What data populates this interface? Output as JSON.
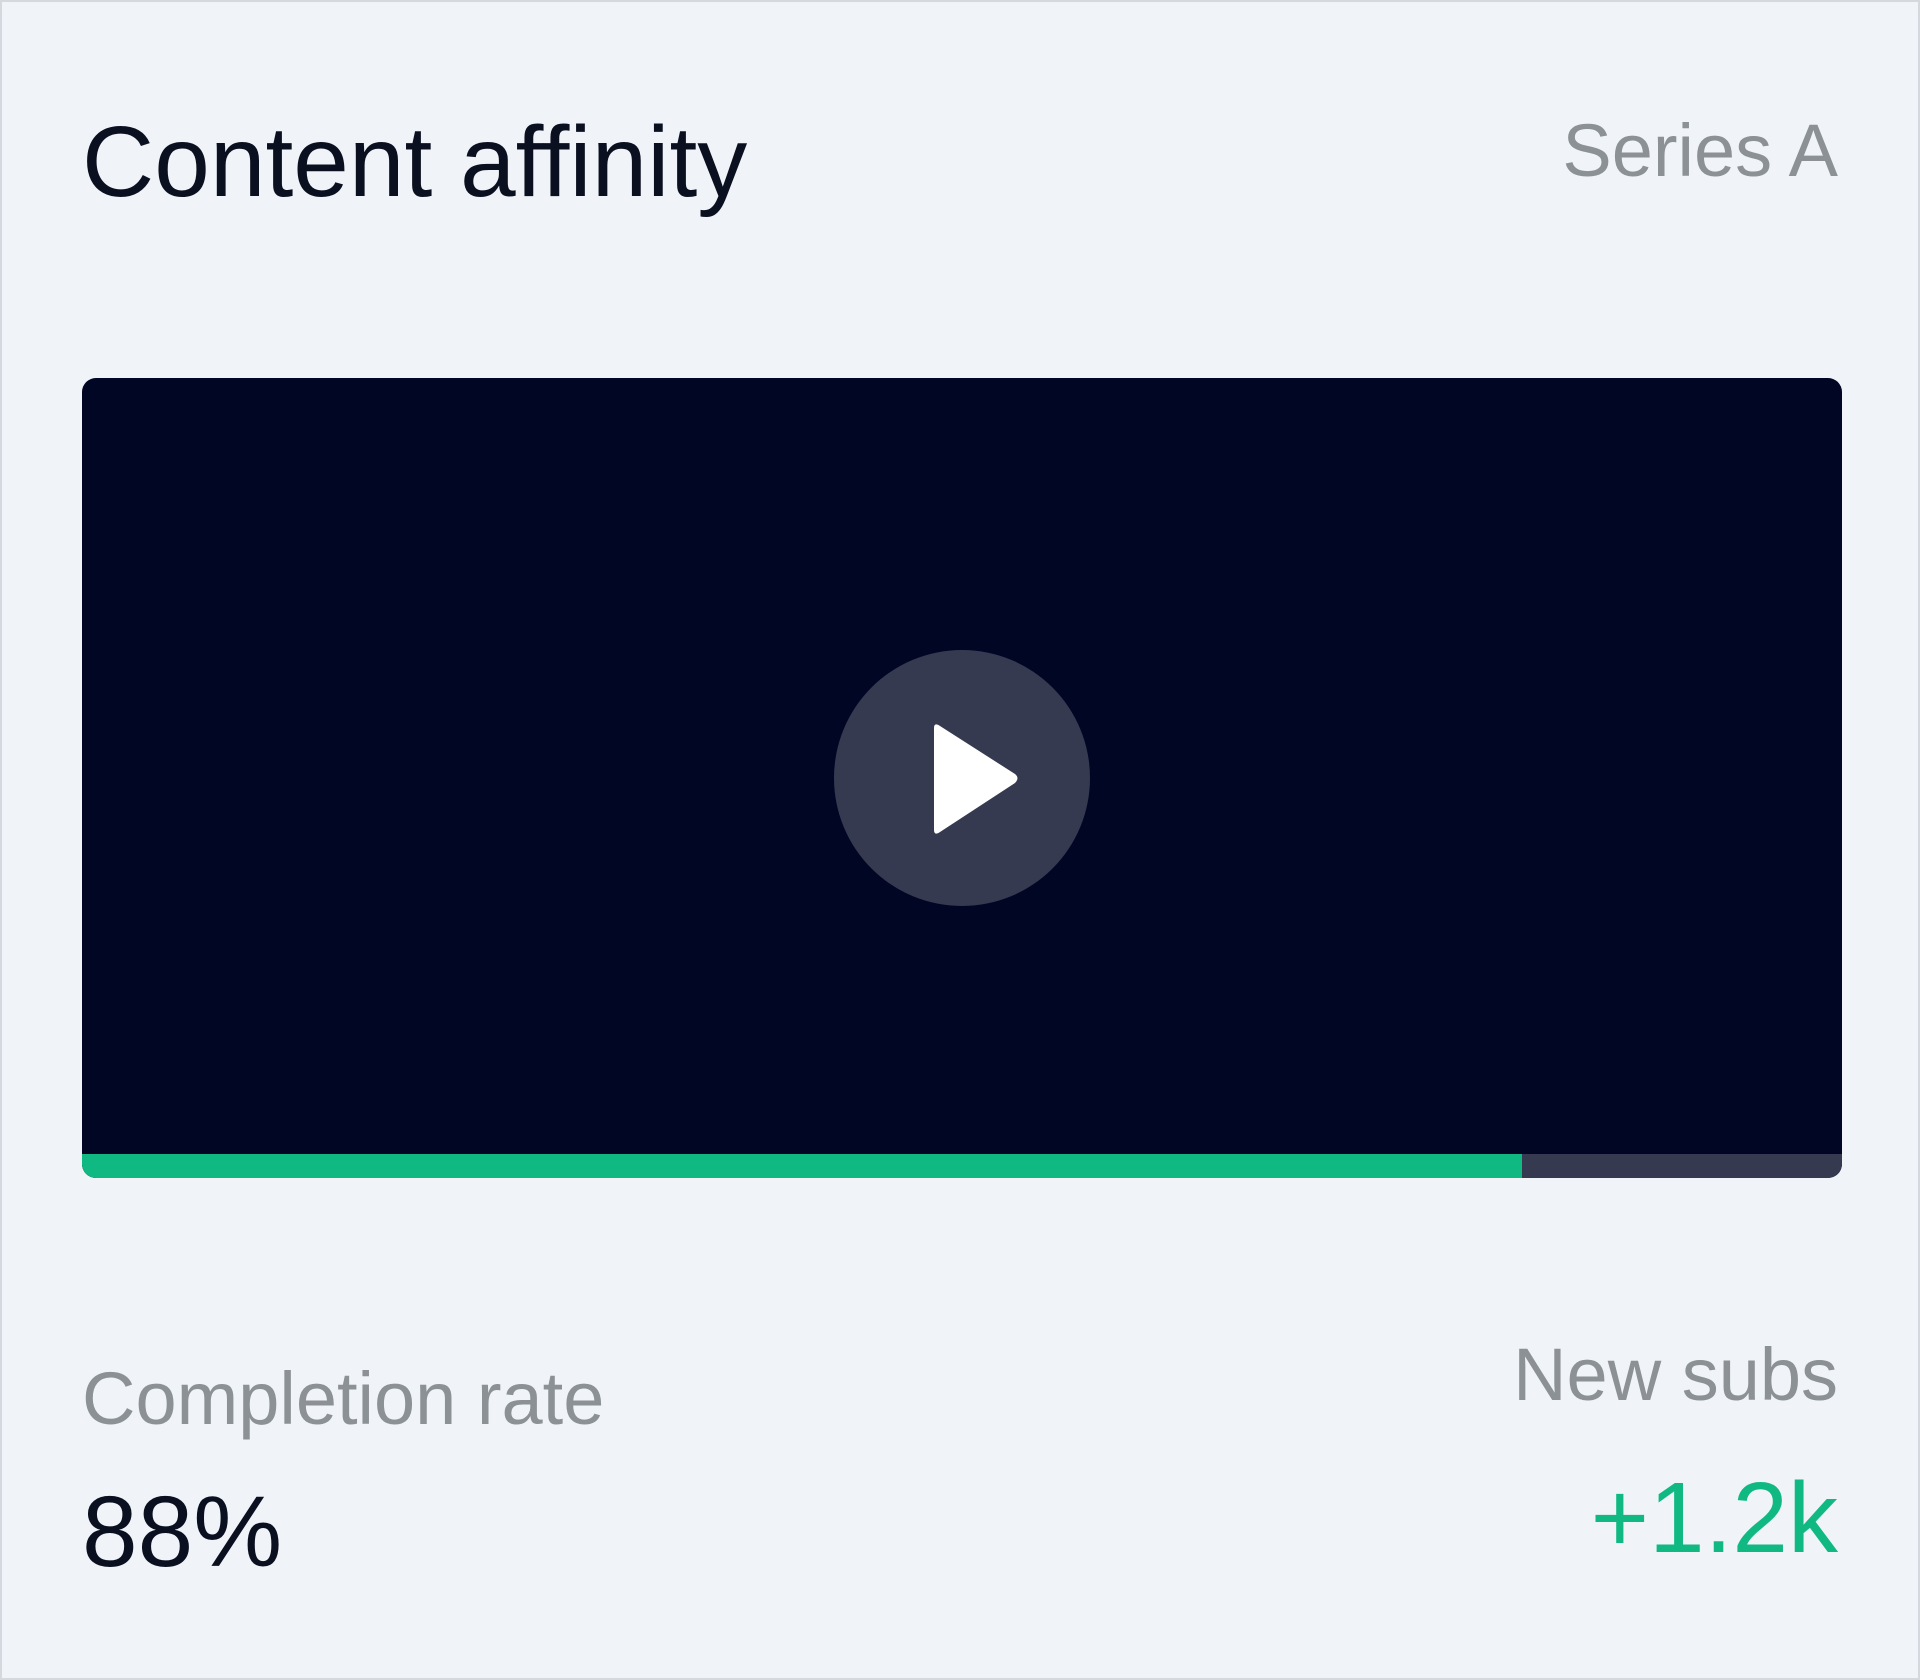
{
  "header": {
    "title": "Content affinity",
    "series_label": "Series A"
  },
  "player": {
    "play_icon": "play-icon",
    "progress_fraction": 0.818,
    "colors": {
      "background": "#000624",
      "button": "#363a50",
      "progress_fill": "#10b981",
      "progress_track": "#363a50"
    }
  },
  "metrics": {
    "completion": {
      "label": "Completion rate",
      "value": "88%"
    },
    "new_subs": {
      "label": "New subs",
      "value": "+1.2k",
      "color": "#10b981"
    }
  }
}
